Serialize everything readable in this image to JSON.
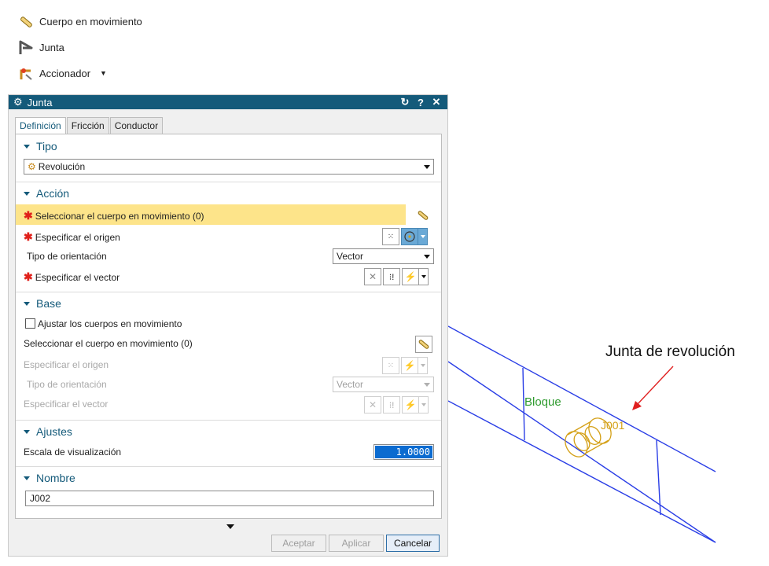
{
  "ribbon": {
    "items": [
      {
        "label": "Cuerpo en movimiento",
        "icon": "link-body-icon"
      },
      {
        "label": "Junta",
        "icon": "joint-icon"
      },
      {
        "label": "Accionador",
        "icon": "driver-icon"
      }
    ]
  },
  "dialog": {
    "title": "Junta",
    "tabs": [
      "Definición",
      "Fricción",
      "Conductor"
    ],
    "sections": {
      "tipo": {
        "title": "Tipo",
        "value": "Revolución"
      },
      "accion": {
        "title": "Acción",
        "select_body": "Seleccionar el cuerpo en movimiento (0)",
        "specify_origin": "Especificar el origen",
        "orientation_label": "Tipo de orientación",
        "orientation_value": "Vector",
        "specify_vector": "Especificar el vector"
      },
      "base": {
        "title": "Base",
        "checkbox_label": "Ajustar los cuerpos en movimiento",
        "select_body": "Seleccionar el cuerpo en movimiento (0)",
        "specify_origin": "Especificar el origen",
        "orientation_label": "Tipo de orientación",
        "orientation_value": "Vector",
        "specify_vector": "Especificar el vector"
      },
      "ajustes": {
        "title": "Ajustes",
        "scale_label": "Escala de visualización",
        "scale_value": "1.0000"
      },
      "nombre": {
        "title": "Nombre",
        "value": "J002"
      }
    },
    "buttons": {
      "ok": "Aceptar",
      "apply": "Aplicar",
      "cancel": "Cancelar"
    }
  },
  "viewport": {
    "annotation": "Junta de revolución",
    "block_label": "Bloque",
    "joint_label": "J001",
    "colors": {
      "wire": "#2a3ee6",
      "joint": "#d4a017",
      "block_text": "#2e9a2e",
      "arrow": "#e02020"
    }
  }
}
